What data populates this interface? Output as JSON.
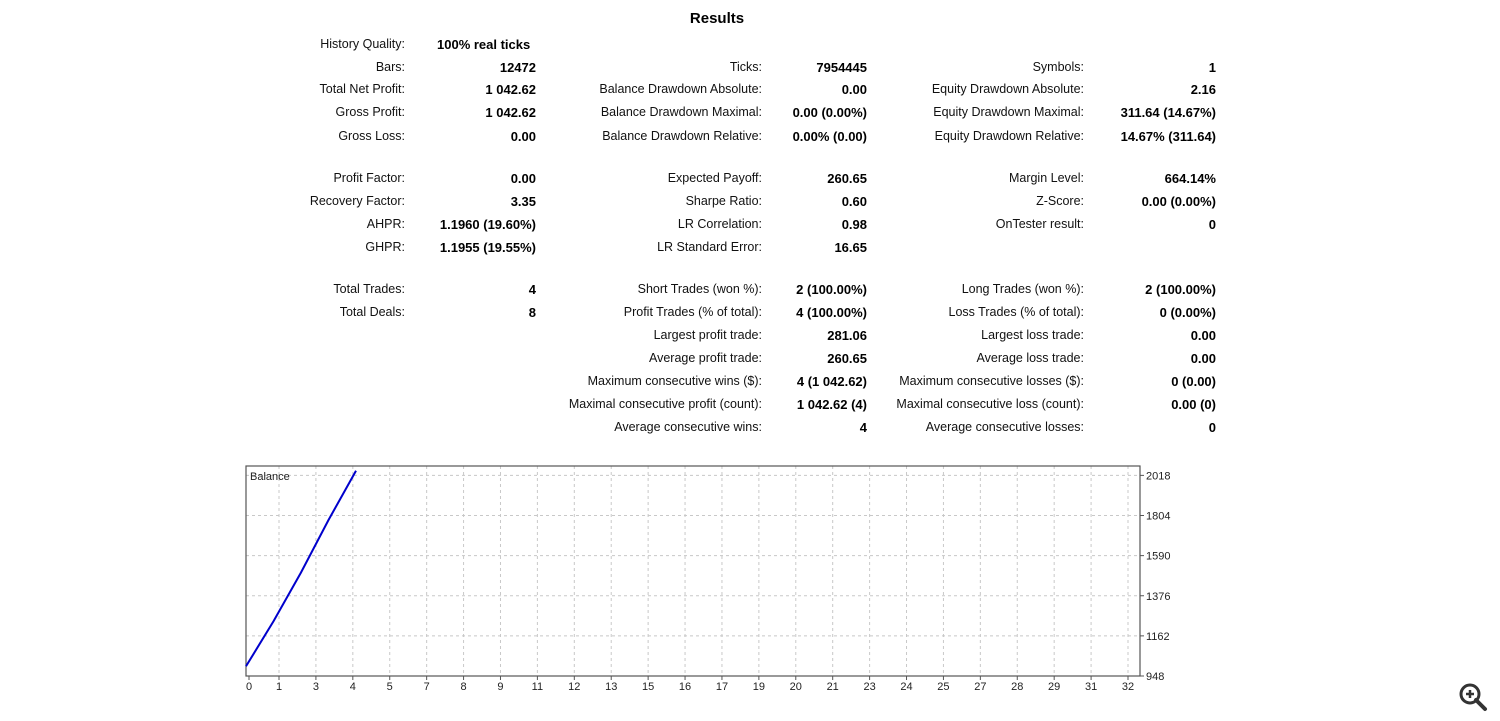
{
  "title": "Results",
  "stats": [
    [
      {
        "label": "History Quality:",
        "value": "100% real ticks"
      },
      null,
      null
    ],
    [
      {
        "label": "Bars:",
        "value": "12472"
      },
      {
        "label": "Ticks:",
        "value": "7954445"
      },
      {
        "label": "Symbols:",
        "value": "1"
      }
    ],
    [
      {
        "label": "Total Net Profit:",
        "value": "1 042.62"
      },
      {
        "label": "Balance Drawdown Absolute:",
        "value": "0.00"
      },
      {
        "label": "Equity Drawdown Absolute:",
        "value": "2.16"
      }
    ],
    [
      {
        "label": "Gross Profit:",
        "value": "1 042.62"
      },
      {
        "label": "Balance Drawdown Maximal:",
        "value": "0.00 (0.00%)"
      },
      {
        "label": "Equity Drawdown Maximal:",
        "value": "311.64 (14.67%)"
      }
    ],
    [
      {
        "label": "Gross Loss:",
        "value": "0.00"
      },
      {
        "label": "Balance Drawdown Relative:",
        "value": "0.00% (0.00)"
      },
      {
        "label": "Equity Drawdown Relative:",
        "value": "14.67% (311.64)"
      }
    ],
    [
      {
        "label": "Profit Factor:",
        "value": "0.00"
      },
      {
        "label": "Expected Payoff:",
        "value": "260.65"
      },
      {
        "label": "Margin Level:",
        "value": "664.14%"
      }
    ],
    [
      {
        "label": "Recovery Factor:",
        "value": "3.35"
      },
      {
        "label": "Sharpe Ratio:",
        "value": "0.60"
      },
      {
        "label": "Z-Score:",
        "value": "0.00 (0.00%)"
      }
    ],
    [
      {
        "label": "AHPR:",
        "value": "1.1960 (19.60%)"
      },
      {
        "label": "LR Correlation:",
        "value": "0.98"
      },
      {
        "label": "OnTester result:",
        "value": "0"
      }
    ],
    [
      {
        "label": "GHPR:",
        "value": "1.1955 (19.55%)"
      },
      {
        "label": "LR Standard Error:",
        "value": "16.65"
      },
      null
    ],
    [
      {
        "label": "Total Trades:",
        "value": "4"
      },
      {
        "label": "Short Trades (won %):",
        "value": "2 (100.00%)"
      },
      {
        "label": "Long Trades (won %):",
        "value": "2 (100.00%)"
      }
    ],
    [
      {
        "label": "Total Deals:",
        "value": "8"
      },
      {
        "label": "Profit Trades (% of total):",
        "value": "4 (100.00%)"
      },
      {
        "label": "Loss Trades (% of total):",
        "value": "0 (0.00%)"
      }
    ],
    [
      null,
      {
        "label": "Largest profit trade:",
        "value": "281.06"
      },
      {
        "label": "Largest loss trade:",
        "value": "0.00"
      }
    ],
    [
      null,
      {
        "label": "Average profit trade:",
        "value": "260.65"
      },
      {
        "label": "Average loss trade:",
        "value": "0.00"
      }
    ],
    [
      null,
      {
        "label": "Maximum consecutive wins ($):",
        "value": "4 (1 042.62)"
      },
      {
        "label": "Maximum consecutive losses ($):",
        "value": "0 (0.00)"
      }
    ],
    [
      null,
      {
        "label": "Maximal consecutive profit (count):",
        "value": "1 042.62 (4)"
      },
      {
        "label": "Maximal consecutive loss (count):",
        "value": "0.00 (0)"
      }
    ],
    [
      null,
      {
        "label": "Average consecutive wins:",
        "value": "4"
      },
      {
        "label": "Average consecutive losses:",
        "value": "0"
      }
    ]
  ],
  "chart_data": {
    "type": "line",
    "title": "Balance",
    "series": [
      {
        "name": "Balance",
        "color": "#0000cc",
        "x": [
          0,
          1,
          2,
          3,
          4
        ],
        "values": [
          1000,
          1240,
          1500,
          1780,
          2042.62
        ]
      }
    ],
    "x_tick_labels": [
      "0",
      "1",
      "3",
      "4",
      "5",
      "7",
      "8",
      "9",
      "11",
      "12",
      "13",
      "15",
      "16",
      "17",
      "19",
      "20",
      "21",
      "23",
      "24",
      "25",
      "27",
      "28",
      "29",
      "31",
      "32"
    ],
    "y_ticks": [
      948,
      1162,
      1376,
      1590,
      1804,
      2018
    ],
    "ylim": [
      948,
      2068
    ],
    "grid": true
  },
  "icons": {
    "zoom": "zoom-in-icon"
  }
}
